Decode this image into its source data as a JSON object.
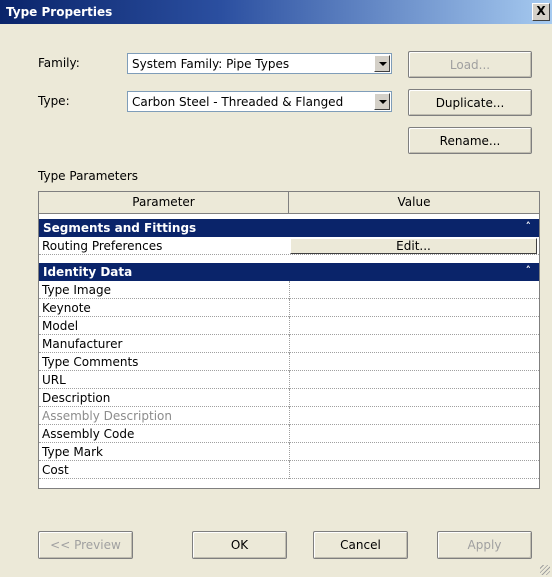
{
  "window": {
    "title": "Type Properties",
    "close_glyph": "X"
  },
  "family": {
    "label": "Family:",
    "value": "System Family: Pipe Types",
    "load_label": "Load..."
  },
  "type": {
    "label": "Type:",
    "value": "Carbon Steel - Threaded & Flanged",
    "duplicate_label": "Duplicate...",
    "rename_label": "Rename..."
  },
  "params": {
    "section_label": "Type Parameters",
    "col_parameter": "Parameter",
    "col_value": "Value",
    "groups": [
      {
        "title": "Segments and Fittings",
        "collapse_glyph": "˄",
        "rows": [
          {
            "name": "Routing Preferences",
            "value_button": "Edit..."
          }
        ]
      },
      {
        "title": "Identity Data",
        "collapse_glyph": "˄",
        "rows": [
          {
            "name": "Type Image"
          },
          {
            "name": "Keynote"
          },
          {
            "name": "Model"
          },
          {
            "name": "Manufacturer"
          },
          {
            "name": "Type Comments"
          },
          {
            "name": "URL"
          },
          {
            "name": "Description"
          },
          {
            "name": "Assembly Description",
            "disabled": true
          },
          {
            "name": "Assembly Code"
          },
          {
            "name": "Type Mark"
          },
          {
            "name": "Cost"
          }
        ]
      }
    ]
  },
  "footer": {
    "preview_label": "<< Preview",
    "ok_label": "OK",
    "cancel_label": "Cancel",
    "apply_label": "Apply"
  },
  "colors": {
    "titlebar": "#0a246a",
    "group_header": "#0a246a",
    "dialog_bg": "#ece9d8"
  }
}
